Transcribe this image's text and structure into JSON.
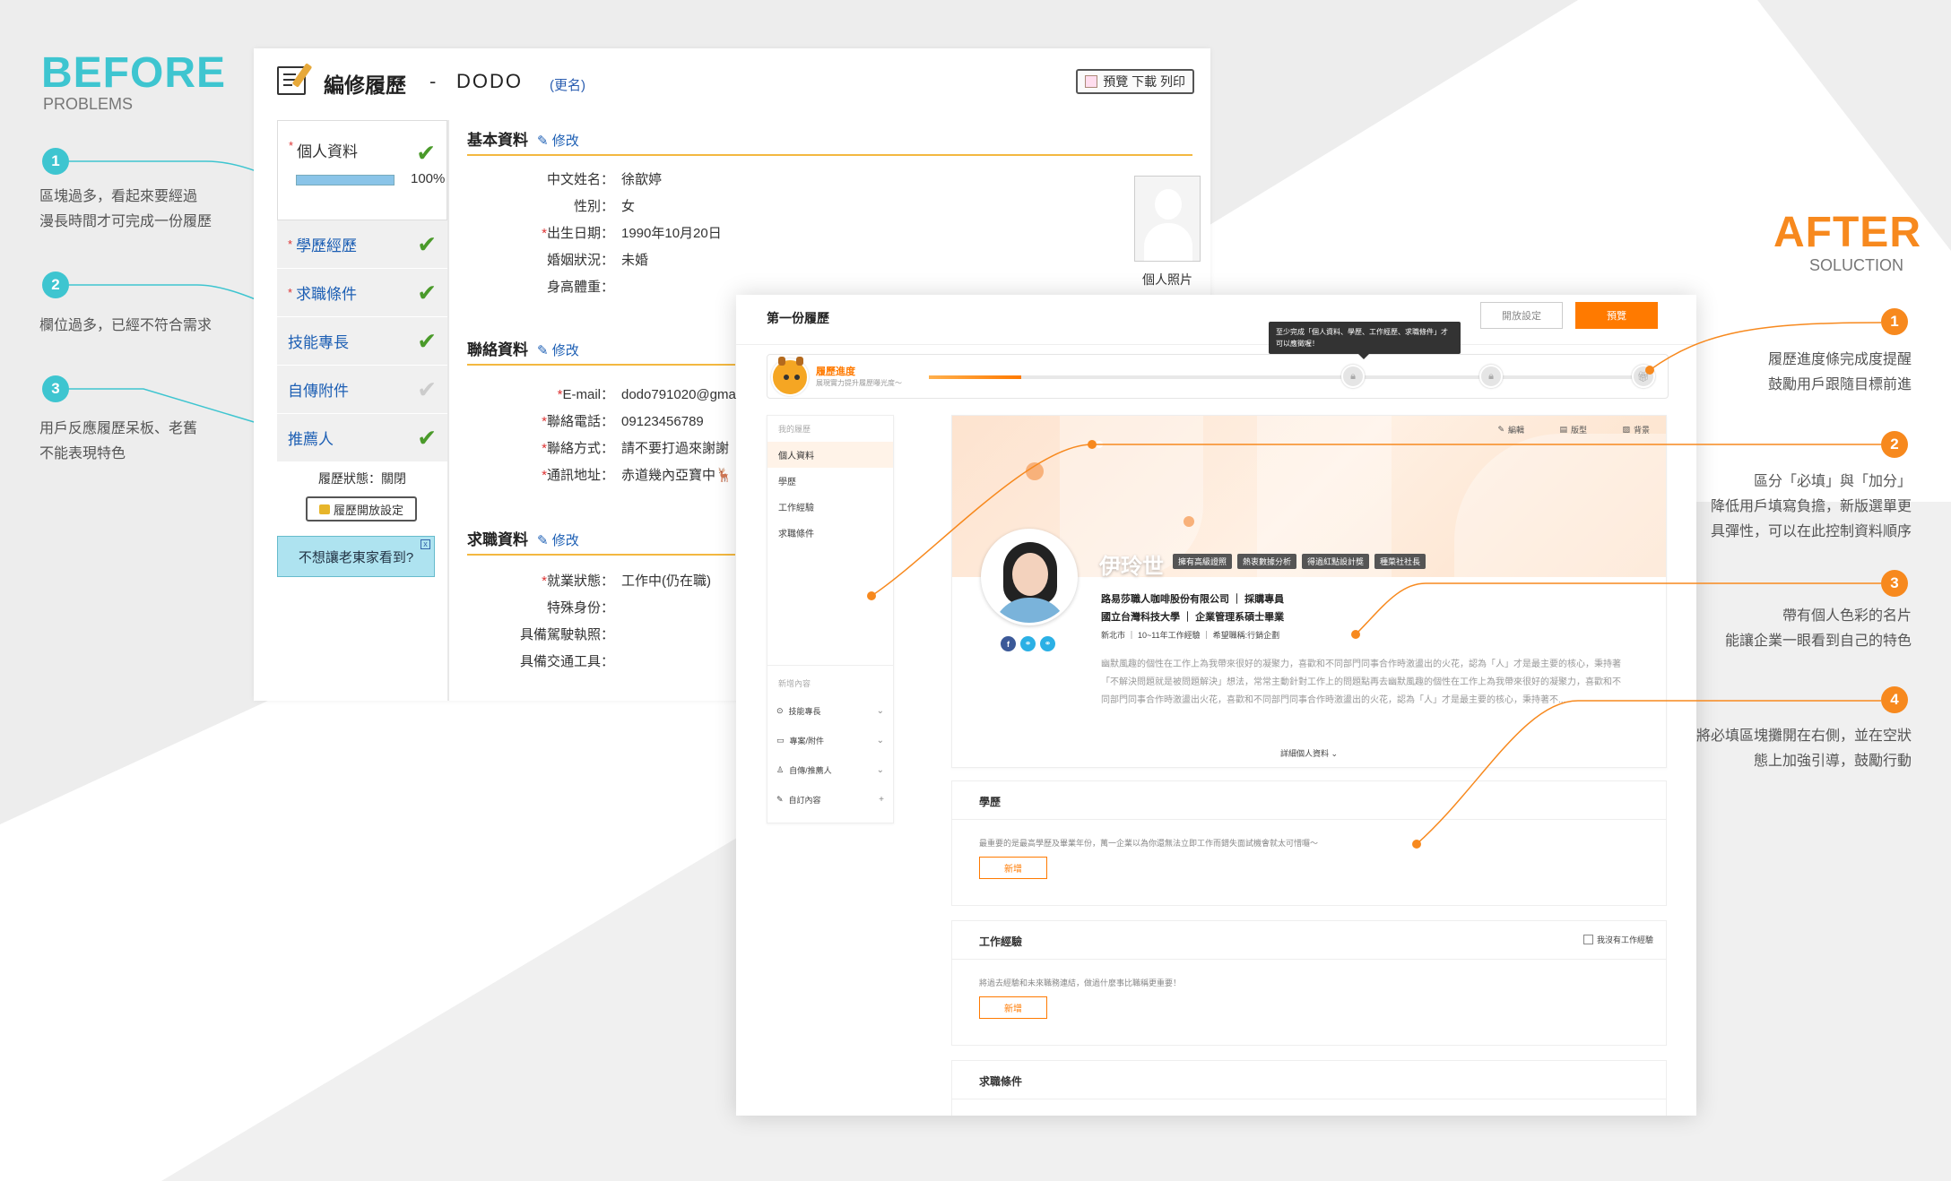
{
  "before": {
    "heading": "BEFORE",
    "subheading": "PROBLEMS",
    "notes": [
      {
        "num": "1",
        "line1": "區塊過多，看起來要經過",
        "line2": "漫長時間才可完成一份履歷"
      },
      {
        "num": "2",
        "line1": "欄位過多，已經不符合需求",
        "line2": ""
      },
      {
        "num": "3",
        "line1": "用戶反應履歷呆板、老舊",
        "line2": "不能表現特色"
      }
    ],
    "panel": {
      "title": "編修履歷",
      "dash": "-",
      "name": "DODO",
      "rename": "(更名)",
      "print_btn": "預覽 下載 列印",
      "side": [
        {
          "label": "個人資料",
          "req": "*",
          "check": "✔"
        },
        {
          "label": "學歷經歷",
          "req": "*",
          "check": "✔"
        },
        {
          "label": "求職條件",
          "req": "*",
          "check": "✔"
        },
        {
          "label": "技能專長",
          "req": "",
          "check": "✔"
        },
        {
          "label": "自傳附件",
          "req": "",
          "check": "✔"
        },
        {
          "label": "推薦人",
          "req": "",
          "check": "✔"
        }
      ],
      "progress": "100%",
      "status": "履歷狀態：關閉",
      "open_btn": "履歷開放設定",
      "tip": "不想讓老東家看到?",
      "tip_close": "x",
      "edit_label": "修改",
      "sections": [
        {
          "title": "基本資料",
          "fields": [
            {
              "req": "",
              "label": "中文姓名：",
              "value": "徐歆婷"
            },
            {
              "req": "",
              "label": "性別：",
              "value": "女"
            },
            {
              "req": "*",
              "label": "出生日期：",
              "value": "1990年10月20日"
            },
            {
              "req": "",
              "label": "婚姻狀況：",
              "value": "未婚"
            },
            {
              "req": "",
              "label": "身高體重：",
              "value": ""
            }
          ]
        },
        {
          "title": "聯絡資料",
          "fields": [
            {
              "req": "*",
              "label": "E-mail：",
              "value": "dodo791020@gmail.c"
            },
            {
              "req": "*",
              "label": "聯絡電話：",
              "value": "09123456789"
            },
            {
              "req": "*",
              "label": "聯絡方式：",
              "value": "請不要打過來謝謝"
            },
            {
              "req": "*",
              "label": "通訊地址：",
              "value": "赤道幾內亞寶中🦌"
            }
          ]
        },
        {
          "title": "求職資料",
          "fields": [
            {
              "req": "*",
              "label": "就業狀態：",
              "value": "工作中(仍在職)"
            },
            {
              "req": "",
              "label": "特殊身份：",
              "value": ""
            },
            {
              "req": "",
              "label": "具備駕駛執照：",
              "value": ""
            },
            {
              "req": "",
              "label": "具備交通工具：",
              "value": ""
            }
          ]
        }
      ],
      "photo_label": "個人照片"
    }
  },
  "after": {
    "heading": "AFTER",
    "subheading": "SOLUCTION",
    "notes": [
      {
        "num": "1",
        "line1": "履歷進度條完成度提醒",
        "line2": "鼓勵用戶跟隨目標前進",
        "line3": ""
      },
      {
        "num": "2",
        "line1": "區分「必填」與「加分」",
        "line2": "降低用戶填寫負擔，新版選單更",
        "line3": "具彈性，可以在此控制資料順序"
      },
      {
        "num": "3",
        "line1": "帶有個人色彩的名片",
        "line2": "能讓企業一眼看到自己的特色",
        "line3": ""
      },
      {
        "num": "4",
        "line1": "將必填區塊攤開在右側，並在空狀",
        "line2": "態上加強引導，鼓勵行動",
        "line3": ""
      }
    ],
    "panel": {
      "title": "第一份履歷",
      "open_btn": "開放設定",
      "preview_btn": "預覽",
      "progress_title": "履歷進度",
      "progress_sub": "展現實力提升履歷曝光度～",
      "progress_fraction": 0.13,
      "tooltip": "至少完成「個人資料、學歷、工作經歷、求職條件」才可以應徵喔！",
      "side_group1": "我的履歷",
      "side_items": [
        "個人資料",
        "學歷",
        "工作經驗",
        "求職條件"
      ],
      "side_group2": "新增內容",
      "side_items2": [
        {
          "label": "技能專長",
          "icon": "⊙",
          "arrow": "⌄"
        },
        {
          "label": "專案/附件",
          "icon": "▭",
          "arrow": "⌄"
        },
        {
          "label": "自傳/推薦人",
          "icon": "♙",
          "arrow": "⌄"
        },
        {
          "label": "自訂內容",
          "icon": "✎",
          "arrow": "+"
        }
      ],
      "banner_actions": [
        {
          "icon": "✎",
          "label": "編輯"
        },
        {
          "icon": "▤",
          "label": "版型"
        },
        {
          "icon": "▨",
          "label": "背景"
        }
      ],
      "name": "伊玲世",
      "tags": [
        "擁有高級證照",
        "熱衷數據分析",
        "得過紅點設計獎",
        "種菜社社長"
      ],
      "company": "路易莎職人咖啡股份有限公司",
      "job_title": "採購專員",
      "school": "國立台灣科技大學",
      "major": "企業管理系碩士畢業",
      "location": "新北市",
      "experience": "10~11年工作經驗",
      "desired": "希望職稱:行銷企劃",
      "social": [
        "f",
        "⚭",
        "⚭"
      ],
      "description": "幽默風趣的個性在工作上為我帶來很好的凝聚力，喜歡和不同部門同事合作時激盪出的火花，認為「人」才是最主要的核心，秉持著「不解決問題就是被問題解決」想法，常常主動針對工作上的問題點再去幽默風趣的個性在工作上為我帶來很好的凝聚力，喜歡和不同部門同事合作時激盪出火花，喜歡和不同部門同事合作時激盪出的火花，認為「人」才是最主要的核心，秉持著不...",
      "more": "詳細個人資料 ⌄",
      "education": {
        "title": "學歷",
        "desc": "最重要的是最高學歷及畢業年份，萬一企業以為你還無法立即工作而錯失面試機會就太可惜囉～",
        "add": "新增"
      },
      "work": {
        "title": "工作經驗",
        "desc": "將過去經驗和未來職務連結，做過什麼事比職稱更重要！",
        "add": "新增",
        "checkbox": "我沒有工作經驗"
      },
      "conditions": {
        "title": "求職條件"
      }
    }
  },
  "colors": {
    "teal": "#3ec5d0",
    "orange": "#f7891e",
    "accent_after": "#ff7a00"
  }
}
